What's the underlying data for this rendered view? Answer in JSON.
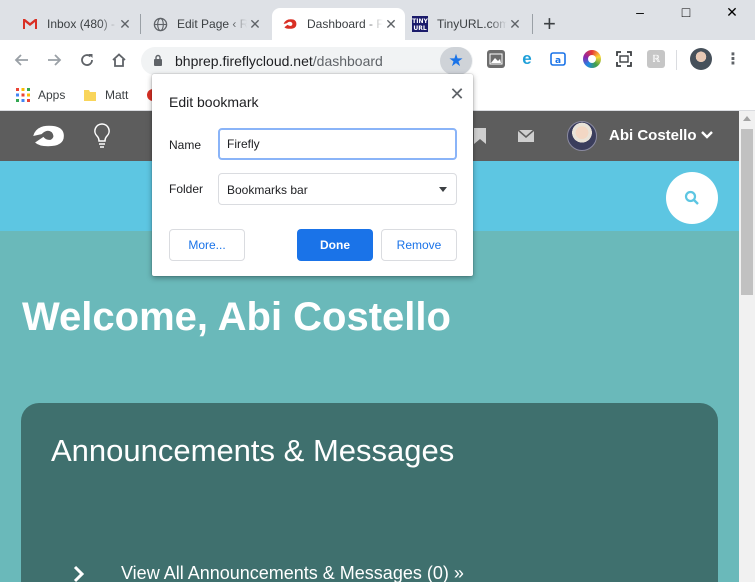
{
  "browser": {
    "tabs": [
      {
        "title": "Inbox (480) - ",
        "icon": "gmail-icon",
        "active": false
      },
      {
        "title": "Edit Page ‹ Rec",
        "icon": "globe-icon",
        "active": false
      },
      {
        "title": "Dashboard - Fire",
        "icon": "firefly-icon",
        "active": true
      },
      {
        "title": "TinyURL.com",
        "icon": "tinyurl-icon",
        "active": false
      }
    ],
    "new_tab_label": "+",
    "window_controls": {
      "minimize": "–",
      "maximize": "□",
      "close": "✕"
    },
    "address": {
      "host": "bhprep.fireflycloud.net",
      "path": "/dashboard"
    },
    "bookmarks": [
      {
        "label": "Apps",
        "icon": "apps-grid-icon"
      },
      {
        "label": "Matt",
        "icon": "folder-icon"
      }
    ],
    "extensions": [
      "photo-extension-icon",
      "edge-extension-icon",
      "translate-extension-icon",
      "colorzilla-extension-icon",
      "screenshot-extension-icon",
      "grey-extension-icon"
    ]
  },
  "site": {
    "user_name": "Abi Costello",
    "welcome_text": "Welcome, Abi Costello",
    "card": {
      "title": "Announcements & Messages",
      "link_text": "View All Announcements & Messages (0) »"
    },
    "colors": {
      "header": "#5d5d5d",
      "band": "#5dc6e2",
      "background": "#6ab9ba",
      "card": "#3f706e"
    }
  },
  "dialog": {
    "title": "Edit bookmark",
    "name_label": "Name",
    "name_value": "Firefly",
    "folder_label": "Folder",
    "folder_value": "Bookmarks bar",
    "more_label": "More...",
    "done_label": "Done",
    "remove_label": "Remove",
    "close_label": "✕"
  }
}
